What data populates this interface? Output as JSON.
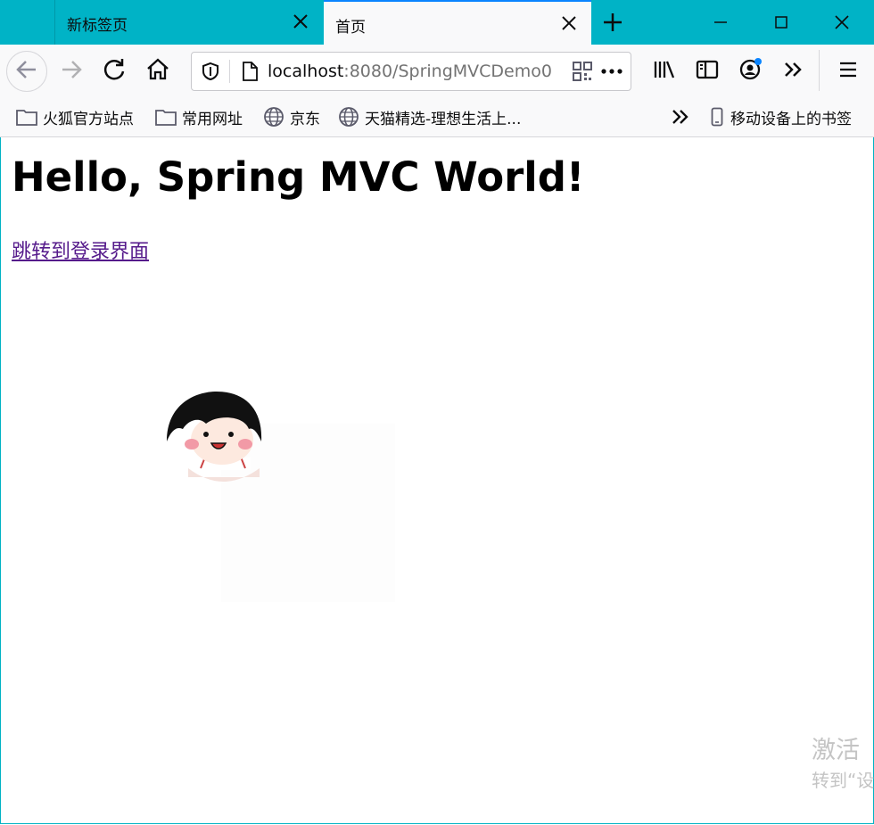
{
  "tabs": [
    {
      "label": "新标签页",
      "active": false
    },
    {
      "label": "首页",
      "active": true
    }
  ],
  "url": {
    "host": "localhost",
    "rest": ":8080/SpringMVCDemo0"
  },
  "bookmarks": [
    {
      "label": "火狐官方站点",
      "icon": "folder-icon"
    },
    {
      "label": "常用网址",
      "icon": "folder-icon"
    },
    {
      "label": "京东",
      "icon": "globe-icon"
    },
    {
      "label": "天猫精选-理想生活上...",
      "icon": "globe-icon"
    }
  ],
  "mobile_bookmarks": "移动设备上的书签",
  "page": {
    "heading": "Hello, Spring MVC World!",
    "link": "跳转到登录界面"
  },
  "watermark": {
    "line1": "激活",
    "line2": "转到“设"
  },
  "colors": {
    "titlebar": "#00b3c6",
    "accent": "#0a84ff",
    "link": "#551a8b"
  }
}
